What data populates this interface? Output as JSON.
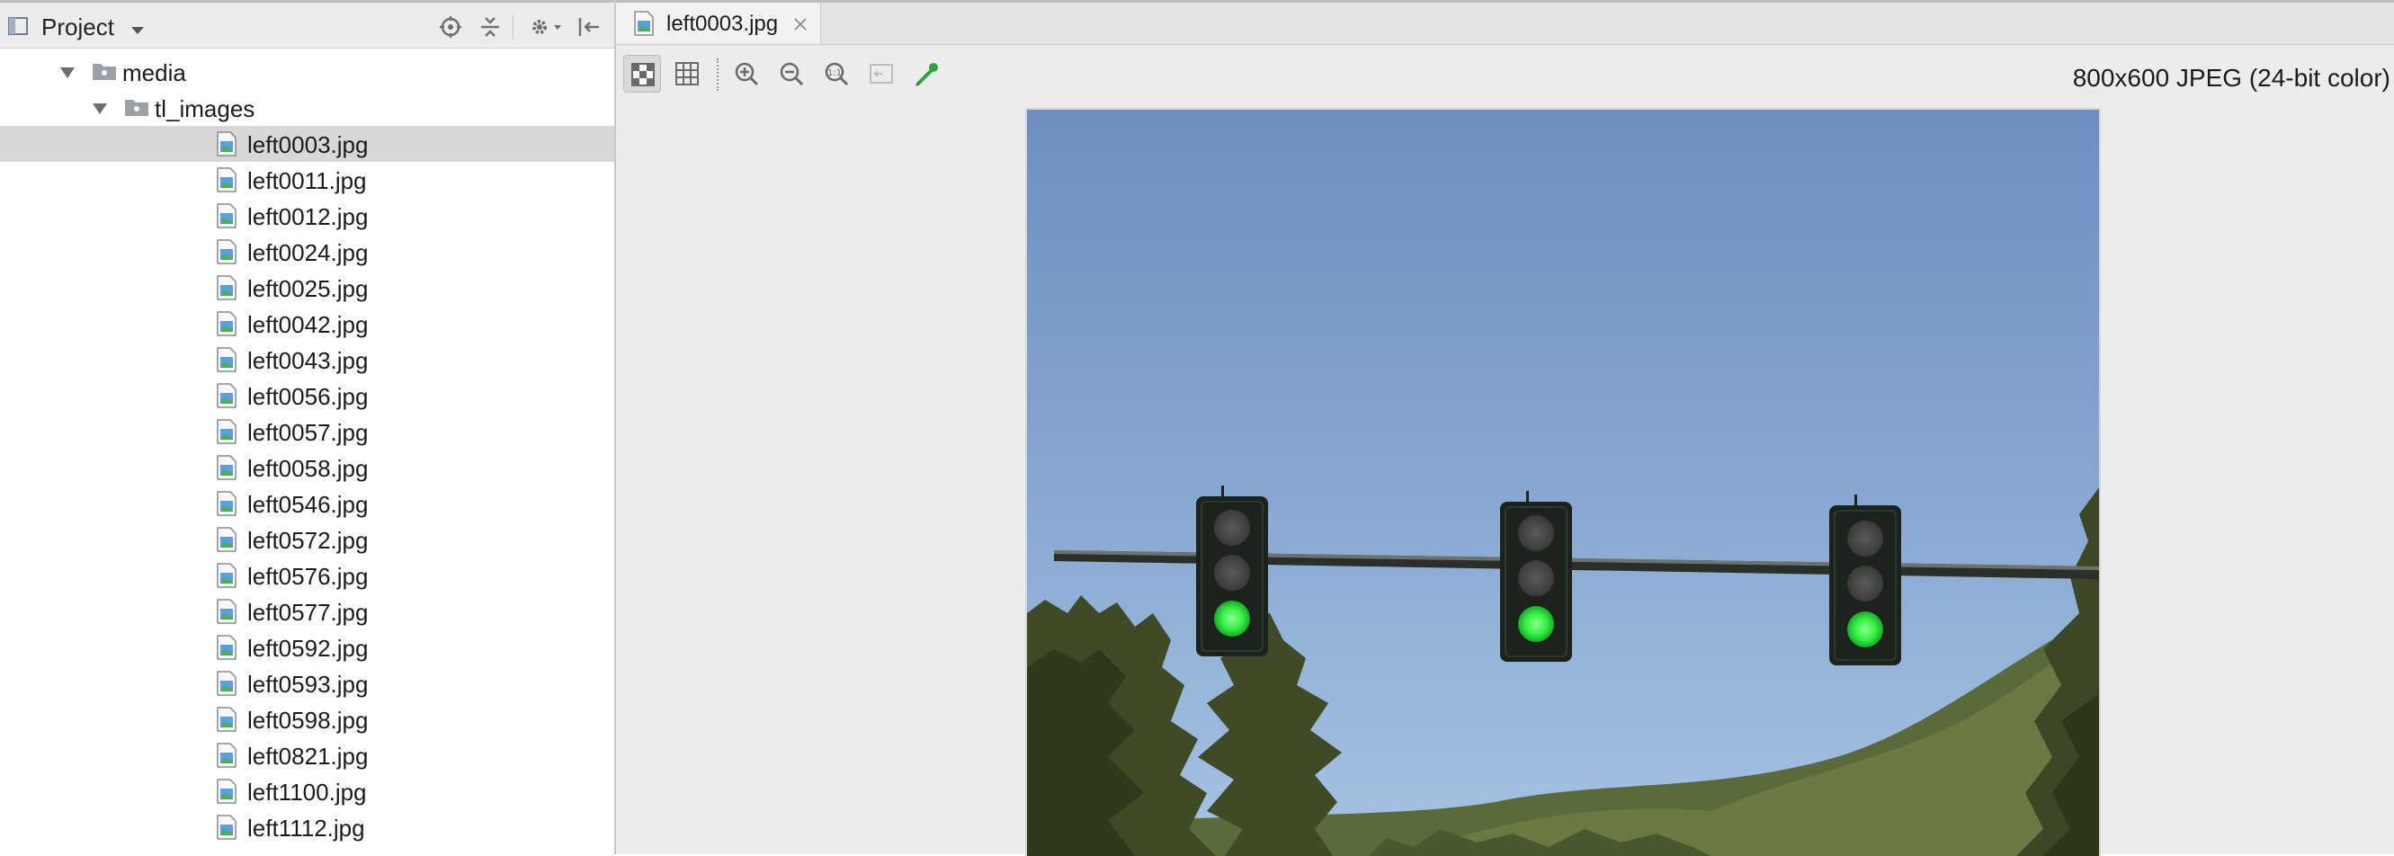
{
  "project_panel": {
    "title": "Project",
    "tree": [
      {
        "label": "media",
        "type": "folder",
        "level": 1,
        "expanded": true
      },
      {
        "label": "tl_images",
        "type": "folder",
        "level": 2,
        "expanded": true
      },
      {
        "label": "left0003.jpg",
        "type": "file",
        "level": 3,
        "selected": true
      },
      {
        "label": "left0011.jpg",
        "type": "file",
        "level": 3
      },
      {
        "label": "left0012.jpg",
        "type": "file",
        "level": 3
      },
      {
        "label": "left0024.jpg",
        "type": "file",
        "level": 3
      },
      {
        "label": "left0025.jpg",
        "type": "file",
        "level": 3
      },
      {
        "label": "left0042.jpg",
        "type": "file",
        "level": 3
      },
      {
        "label": "left0043.jpg",
        "type": "file",
        "level": 3
      },
      {
        "label": "left0056.jpg",
        "type": "file",
        "level": 3
      },
      {
        "label": "left0057.jpg",
        "type": "file",
        "level": 3
      },
      {
        "label": "left0058.jpg",
        "type": "file",
        "level": 3
      },
      {
        "label": "left0546.jpg",
        "type": "file",
        "level": 3
      },
      {
        "label": "left0572.jpg",
        "type": "file",
        "level": 3
      },
      {
        "label": "left0576.jpg",
        "type": "file",
        "level": 3
      },
      {
        "label": "left0577.jpg",
        "type": "file",
        "level": 3
      },
      {
        "label": "left0592.jpg",
        "type": "file",
        "level": 3
      },
      {
        "label": "left0593.jpg",
        "type": "file",
        "level": 3
      },
      {
        "label": "left0598.jpg",
        "type": "file",
        "level": 3
      },
      {
        "label": "left0821.jpg",
        "type": "file",
        "level": 3
      },
      {
        "label": "left1100.jpg",
        "type": "file",
        "level": 3
      },
      {
        "label": "left1112.jpg",
        "type": "file",
        "level": 3
      }
    ],
    "header_icons": [
      "locate-icon",
      "collapse-all-icon",
      "gear-icon",
      "hide-panel-icon"
    ]
  },
  "editor": {
    "tab": {
      "label": "left0003.jpg",
      "icons": [
        "image-file-icon",
        "close-icon"
      ]
    },
    "toolbar": [
      {
        "name": "chessboard-background-icon",
        "active": true
      },
      {
        "name": "grid-icon",
        "active": false
      },
      {
        "name": "zoom-in-icon",
        "active": false
      },
      {
        "name": "zoom-out-icon",
        "active": false
      },
      {
        "name": "actual-size-icon",
        "active": false
      },
      {
        "name": "fit-to-window-icon",
        "active": false,
        "disabled": true
      },
      {
        "name": "color-picker-icon",
        "active": false
      }
    ],
    "image_info": "800x600 JPEG (24-bit color)"
  },
  "colors": {
    "selection": "#d7d7d7",
    "panel_header": "#ececec",
    "sky": "#7896c0",
    "green_light": "#33ee44",
    "picker_green": "#2aa53a"
  }
}
